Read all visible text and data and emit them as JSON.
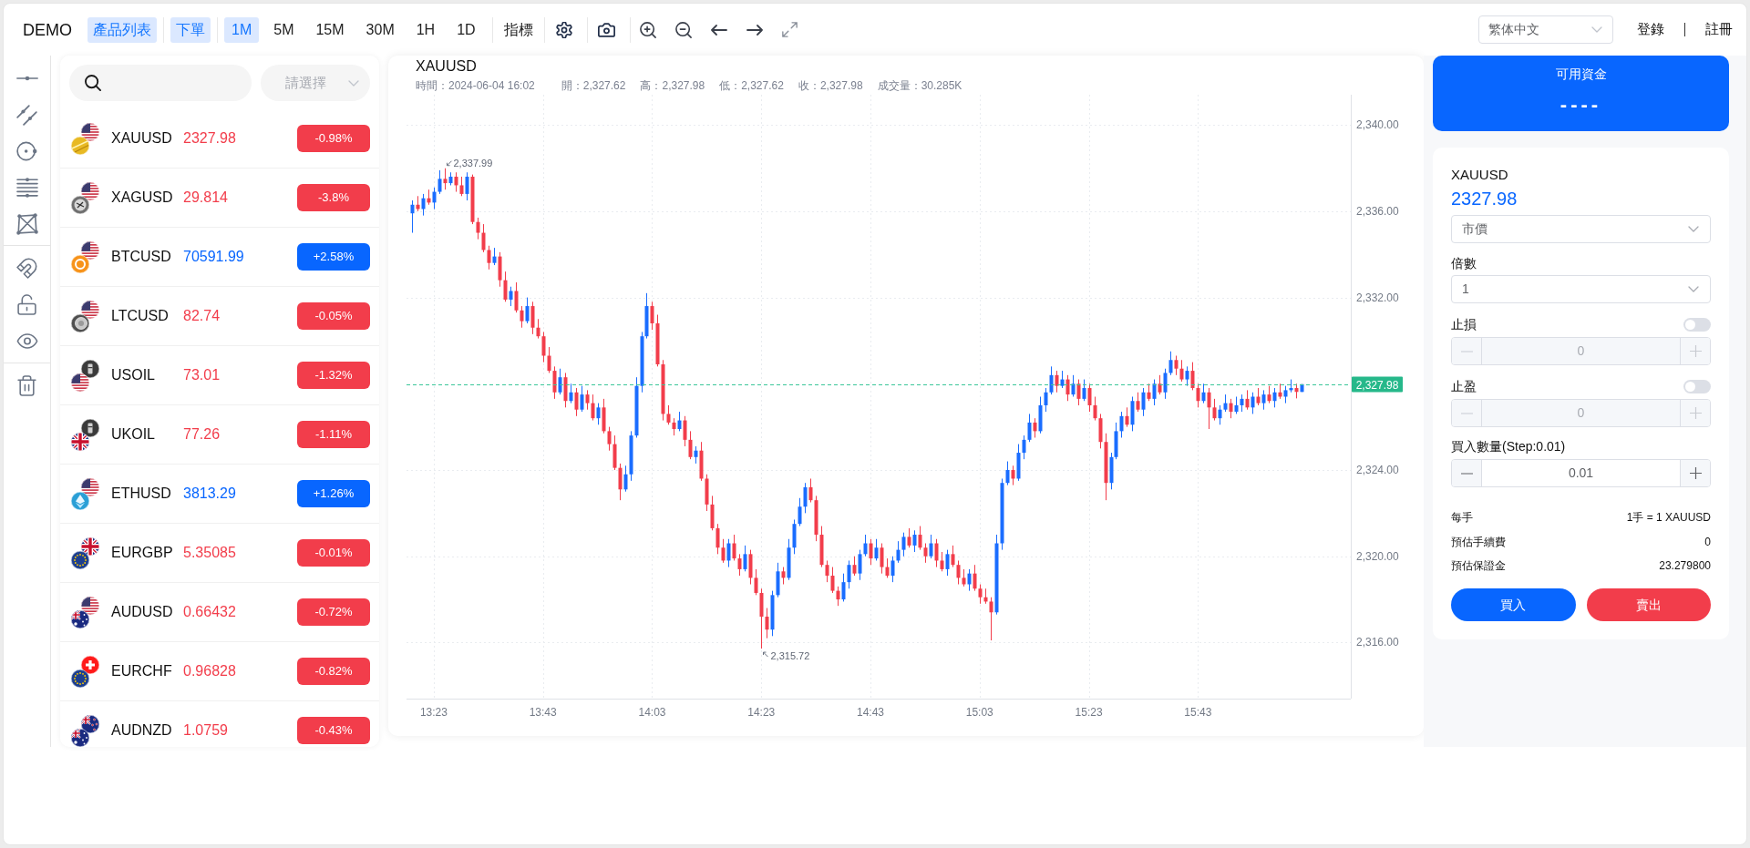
{
  "header": {
    "brand": "DEMO",
    "panels": [
      {
        "label": "產品列表",
        "on": true
      },
      {
        "label": "下單",
        "on": true
      }
    ],
    "timeframes": [
      {
        "label": "1M",
        "selected": true
      },
      {
        "label": "5M",
        "selected": false
      },
      {
        "label": "15M",
        "selected": false
      },
      {
        "label": "30M",
        "selected": false
      },
      {
        "label": "1H",
        "selected": false
      },
      {
        "label": "1D",
        "selected": false
      }
    ],
    "indicators": "指標",
    "language": "繁体中文",
    "login": "登錄",
    "register": "註冊"
  },
  "product_list": {
    "filter": {
      "placeholder": "請選擇"
    },
    "rows": [
      {
        "symbol": "XAUUSD",
        "price": "2327.98",
        "change": "-0.98%",
        "up": false
      },
      {
        "symbol": "XAGUSD",
        "price": "29.814",
        "change": "-3.8%",
        "up": false
      },
      {
        "symbol": "BTCUSD",
        "price": "70591.99",
        "change": "+2.58%",
        "up": true
      },
      {
        "symbol": "LTCUSD",
        "price": "82.74",
        "change": "-0.05%",
        "up": false
      },
      {
        "symbol": "USOIL",
        "price": "73.01",
        "change": "-1.32%",
        "up": false
      },
      {
        "symbol": "UKOIL",
        "price": "77.26",
        "change": "-1.11%",
        "up": false
      },
      {
        "symbol": "ETHUSD",
        "price": "3813.29",
        "change": "+1.26%",
        "up": true
      },
      {
        "symbol": "EURGBP",
        "price": "5.35085",
        "change": "-0.01%",
        "up": false
      },
      {
        "symbol": "AUDUSD",
        "price": "0.66432",
        "change": "-0.72%",
        "up": false
      },
      {
        "symbol": "EURCHF",
        "price": "0.96828",
        "change": "-0.82%",
        "up": false
      },
      {
        "symbol": "AUDNZD",
        "price": "1.0759",
        "change": "-0.43%",
        "up": false
      }
    ]
  },
  "chart": {
    "title": "XAUUSD",
    "legend": [
      "時間：2024-06-04 16:02",
      "開：2,327.62",
      "高：2,327.98",
      "低：2,327.62",
      "收：2,327.98",
      "成交量：30.285K"
    ],
    "chart_data": {
      "type": "candlestick",
      "x": [
        799,
        800,
        801,
        802,
        803,
        804,
        805,
        806,
        807,
        808,
        809,
        810,
        811,
        812,
        813,
        814,
        815,
        816,
        817,
        818,
        819,
        820,
        821,
        822,
        823,
        824,
        825,
        826,
        827,
        828,
        829,
        830,
        831,
        832,
        833,
        834,
        835,
        836,
        837,
        838,
        839,
        840,
        841,
        842,
        843,
        844,
        845,
        846,
        847,
        848,
        849,
        850,
        851,
        852,
        853,
        854,
        855,
        856,
        857,
        858,
        859,
        860,
        861,
        862,
        863,
        864,
        865,
        866,
        867,
        868,
        869,
        870,
        871,
        872,
        873,
        874,
        875,
        876,
        877,
        878,
        879,
        880,
        881,
        882,
        883,
        884,
        885,
        886,
        887,
        888,
        889,
        890,
        891,
        892,
        893,
        894,
        895,
        896,
        897,
        898,
        899,
        900,
        901,
        902,
        903,
        904,
        905,
        906,
        907,
        908,
        909,
        910,
        911,
        912,
        913,
        914,
        915,
        916,
        917,
        918,
        919,
        920,
        921,
        922,
        923,
        924,
        925,
        926,
        927,
        928,
        929,
        930,
        931,
        932,
        933,
        934,
        935,
        936,
        937,
        938,
        939,
        940,
        941,
        942,
        943,
        944,
        945,
        946,
        947,
        948,
        949,
        950,
        951,
        952,
        953,
        954,
        955,
        956,
        957,
        958,
        959,
        960,
        961,
        962
      ],
      "ohlc": [
        [
          2335.9,
          2336.5,
          2335.0,
          2336.3
        ],
        [
          2336.3,
          2336.7,
          2336.0,
          2336.1
        ],
        [
          2336.1,
          2336.8,
          2335.8,
          2336.6
        ],
        [
          2336.6,
          2337.0,
          2336.3,
          2336.4
        ],
        [
          2336.4,
          2337.1,
          2336.1,
          2336.9
        ],
        [
          2336.9,
          2337.9,
          2336.8,
          2337.5
        ],
        [
          2337.5,
          2337.99,
          2337.0,
          2337.3
        ],
        [
          2337.3,
          2337.8,
          2337.2,
          2337.6
        ],
        [
          2337.6,
          2337.8,
          2336.9,
          2337.2
        ],
        [
          2337.2,
          2337.6,
          2336.7,
          2336.8
        ],
        [
          2336.8,
          2337.8,
          2336.5,
          2337.6
        ],
        [
          2337.6,
          2337.7,
          2335.4,
          2335.5
        ],
        [
          2335.5,
          2335.7,
          2334.7,
          2335.0
        ],
        [
          2335.0,
          2335.4,
          2334.1,
          2334.2
        ],
        [
          2334.2,
          2334.4,
          2333.3,
          2333.6
        ],
        [
          2333.6,
          2334.3,
          2333.5,
          2333.9
        ],
        [
          2333.9,
          2334.1,
          2332.5,
          2332.8
        ],
        [
          2332.8,
          2333.2,
          2331.8,
          2331.9
        ],
        [
          2331.9,
          2332.5,
          2331.6,
          2332.3
        ],
        [
          2332.3,
          2332.7,
          2331.3,
          2331.4
        ],
        [
          2331.4,
          2331.6,
          2330.6,
          2330.9
        ],
        [
          2330.9,
          2332.0,
          2330.8,
          2331.6
        ],
        [
          2331.6,
          2331.8,
          2330.3,
          2330.6
        ],
        [
          2330.6,
          2331.0,
          2330.1,
          2330.2
        ],
        [
          2330.2,
          2330.4,
          2329.0,
          2329.3
        ],
        [
          2329.3,
          2329.7,
          2328.5,
          2328.6
        ],
        [
          2328.6,
          2328.8,
          2327.3,
          2327.6
        ],
        [
          2327.6,
          2328.7,
          2327.5,
          2328.3
        ],
        [
          2328.3,
          2328.5,
          2326.9,
          2327.2
        ],
        [
          2327.2,
          2328.0,
          2327.1,
          2327.6
        ],
        [
          2327.6,
          2327.8,
          2326.5,
          2326.8
        ],
        [
          2326.8,
          2327.9,
          2326.7,
          2327.5
        ],
        [
          2327.5,
          2327.7,
          2326.8,
          2327.1
        ],
        [
          2327.1,
          2327.5,
          2326.3,
          2326.4
        ],
        [
          2326.4,
          2327.1,
          2326.1,
          2326.9
        ],
        [
          2326.9,
          2327.3,
          2325.7,
          2325.8
        ],
        [
          2325.8,
          2326.0,
          2324.9,
          2325.2
        ],
        [
          2325.2,
          2325.6,
          2324.0,
          2324.1
        ],
        [
          2324.1,
          2324.3,
          2322.6,
          2323.1
        ],
        [
          2323.1,
          2324.2,
          2323.0,
          2323.8
        ],
        [
          2323.8,
          2325.8,
          2323.5,
          2325.6
        ],
        [
          2325.6,
          2328.3,
          2325.5,
          2327.9
        ],
        [
          2327.9,
          2330.4,
          2327.6,
          2330.2
        ],
        [
          2330.2,
          2332.2,
          2330.1,
          2331.6
        ],
        [
          2331.6,
          2331.8,
          2330.5,
          2330.8
        ],
        [
          2330.8,
          2331.2,
          2328.8,
          2328.9
        ],
        [
          2328.9,
          2329.1,
          2326.3,
          2326.6
        ],
        [
          2326.6,
          2327.0,
          2326.1,
          2326.2
        ],
        [
          2326.2,
          2326.4,
          2325.6,
          2325.9
        ],
        [
          2325.9,
          2326.7,
          2325.8,
          2326.3
        ],
        [
          2326.3,
          2326.5,
          2325.1,
          2325.4
        ],
        [
          2325.4,
          2325.8,
          2324.5,
          2324.6
        ],
        [
          2324.6,
          2325.1,
          2324.3,
          2324.9
        ],
        [
          2324.9,
          2325.3,
          2323.5,
          2323.6
        ],
        [
          2323.6,
          2323.8,
          2322.1,
          2322.4
        ],
        [
          2322.4,
          2322.8,
          2321.2,
          2321.3
        ],
        [
          2321.3,
          2321.5,
          2320.1,
          2320.4
        ],
        [
          2320.4,
          2320.8,
          2319.7,
          2319.8
        ],
        [
          2319.8,
          2320.8,
          2319.5,
          2320.6
        ],
        [
          2320.6,
          2321.0,
          2319.8,
          2319.9
        ],
        [
          2319.9,
          2320.1,
          2319.1,
          2319.4
        ],
        [
          2319.4,
          2320.5,
          2319.3,
          2320.1
        ],
        [
          2320.1,
          2320.3,
          2318.7,
          2319.0
        ],
        [
          2319.0,
          2319.4,
          2318.2,
          2318.3
        ],
        [
          2318.3,
          2318.5,
          2315.72,
          2317.2
        ],
        [
          2317.2,
          2317.6,
          2316.2,
          2316.6
        ],
        [
          2316.6,
          2318.4,
          2316.3,
          2318.2
        ],
        [
          2318.2,
          2319.7,
          2318.1,
          2319.3
        ],
        [
          2319.3,
          2319.5,
          2318.7,
          2319.0
        ],
        [
          2319.0,
          2320.8,
          2318.9,
          2320.4
        ],
        [
          2320.4,
          2321.7,
          2320.1,
          2321.5
        ],
        [
          2321.5,
          2322.7,
          2321.4,
          2322.3
        ],
        [
          2322.3,
          2323.4,
          2322.0,
          2323.2
        ],
        [
          2323.2,
          2323.6,
          2322.5,
          2322.6
        ],
        [
          2322.6,
          2322.8,
          2320.7,
          2321.0
        ],
        [
          2321.0,
          2321.4,
          2319.5,
          2319.6
        ],
        [
          2319.6,
          2319.8,
          2318.8,
          2319.1
        ],
        [
          2319.1,
          2319.5,
          2318.3,
          2318.4
        ],
        [
          2318.4,
          2318.6,
          2317.7,
          2318.0
        ],
        [
          2318.0,
          2319.2,
          2317.9,
          2318.8
        ],
        [
          2318.8,
          2319.8,
          2318.5,
          2319.6
        ],
        [
          2319.6,
          2320.0,
          2319.1,
          2319.2
        ],
        [
          2319.2,
          2320.3,
          2318.9,
          2320.1
        ],
        [
          2320.1,
          2321.0,
          2320.0,
          2320.6
        ],
        [
          2320.6,
          2320.8,
          2319.6,
          2319.9
        ],
        [
          2319.9,
          2320.8,
          2319.8,
          2320.4
        ],
        [
          2320.4,
          2320.6,
          2319.2,
          2319.5
        ],
        [
          2319.5,
          2319.9,
          2319.0,
          2319.1
        ],
        [
          2319.1,
          2320.0,
          2318.8,
          2319.8
        ],
        [
          2319.8,
          2320.7,
          2319.7,
          2320.3
        ],
        [
          2320.3,
          2321.1,
          2320.0,
          2320.9
        ],
        [
          2320.9,
          2321.3,
          2320.4,
          2320.5
        ],
        [
          2320.5,
          2321.2,
          2320.2,
          2321.0
        ],
        [
          2321.0,
          2321.4,
          2320.3,
          2320.4
        ],
        [
          2320.4,
          2320.6,
          2319.7,
          2320.0
        ],
        [
          2320.0,
          2321.0,
          2319.9,
          2320.6
        ],
        [
          2320.6,
          2320.8,
          2319.5,
          2319.8
        ],
        [
          2319.8,
          2320.2,
          2319.3,
          2319.4
        ],
        [
          2319.4,
          2320.3,
          2319.1,
          2320.1
        ],
        [
          2320.1,
          2320.5,
          2319.5,
          2319.6
        ],
        [
          2319.6,
          2319.8,
          2318.7,
          2319.0
        ],
        [
          2319.0,
          2319.4,
          2318.6,
          2318.7
        ],
        [
          2318.7,
          2319.4,
          2318.4,
          2319.2
        ],
        [
          2319.2,
          2319.6,
          2318.4,
          2318.5
        ],
        [
          2318.5,
          2318.7,
          2317.8,
          2318.1
        ],
        [
          2318.1,
          2318.5,
          2317.8,
          2317.9
        ],
        [
          2317.9,
          2318.1,
          2316.1,
          2317.4
        ],
        [
          2317.4,
          2321.0,
          2317.3,
          2320.6
        ],
        [
          2320.6,
          2323.6,
          2320.3,
          2323.4
        ],
        [
          2323.4,
          2324.4,
          2323.3,
          2324.0
        ],
        [
          2324.0,
          2324.2,
          2323.3,
          2323.6
        ],
        [
          2323.6,
          2325.2,
          2323.5,
          2324.8
        ],
        [
          2324.8,
          2325.6,
          2324.5,
          2325.4
        ],
        [
          2325.4,
          2326.6,
          2325.3,
          2326.2
        ],
        [
          2326.2,
          2326.4,
          2325.5,
          2325.8
        ],
        [
          2325.8,
          2327.4,
          2325.7,
          2327.0
        ],
        [
          2327.0,
          2327.8,
          2326.7,
          2327.6
        ],
        [
          2327.6,
          2328.8,
          2327.5,
          2328.4
        ],
        [
          2328.4,
          2328.6,
          2327.6,
          2327.9
        ],
        [
          2327.9,
          2328.6,
          2327.8,
          2328.2
        ],
        [
          2328.2,
          2328.4,
          2327.2,
          2327.5
        ],
        [
          2327.5,
          2328.4,
          2327.4,
          2328.0
        ],
        [
          2328.0,
          2328.2,
          2327.0,
          2327.3
        ],
        [
          2327.3,
          2328.2,
          2327.2,
          2327.8
        ],
        [
          2327.8,
          2328.0,
          2326.7,
          2327.0
        ],
        [
          2327.0,
          2327.4,
          2326.3,
          2326.4
        ],
        [
          2326.4,
          2326.6,
          2325.0,
          2325.3
        ],
        [
          2325.3,
          2325.7,
          2322.6,
          2323.4
        ],
        [
          2323.4,
          2324.8,
          2323.1,
          2324.6
        ],
        [
          2324.6,
          2326.2,
          2324.5,
          2325.8
        ],
        [
          2325.8,
          2326.7,
          2325.5,
          2326.5
        ],
        [
          2326.5,
          2326.9,
          2326.0,
          2326.1
        ],
        [
          2326.1,
          2327.4,
          2325.8,
          2327.2
        ],
        [
          2327.2,
          2327.6,
          2326.7,
          2326.8
        ],
        [
          2326.8,
          2327.8,
          2326.5,
          2327.6
        ],
        [
          2327.6,
          2328.0,
          2327.2,
          2327.3
        ],
        [
          2327.3,
          2328.2,
          2327.0,
          2328.0
        ],
        [
          2328.0,
          2328.4,
          2327.5,
          2327.6
        ],
        [
          2327.6,
          2328.7,
          2327.3,
          2328.5
        ],
        [
          2328.5,
          2329.5,
          2328.4,
          2329.1
        ],
        [
          2329.1,
          2329.3,
          2328.4,
          2328.7
        ],
        [
          2328.7,
          2329.1,
          2328.1,
          2328.2
        ],
        [
          2328.2,
          2328.8,
          2327.9,
          2328.6
        ],
        [
          2328.6,
          2329.0,
          2327.7,
          2327.8
        ],
        [
          2327.8,
          2328.0,
          2326.9,
          2327.2
        ],
        [
          2327.2,
          2328.0,
          2327.1,
          2327.6
        ],
        [
          2327.6,
          2327.8,
          2325.9,
          2326.9
        ],
        [
          2326.9,
          2327.3,
          2326.3,
          2326.4
        ],
        [
          2326.4,
          2327.0,
          2326.1,
          2326.8
        ],
        [
          2326.8,
          2327.5,
          2326.7,
          2327.1
        ],
        [
          2327.1,
          2327.3,
          2326.4,
          2326.7
        ],
        [
          2326.7,
          2327.4,
          2326.6,
          2327.0
        ],
        [
          2327.0,
          2327.5,
          2326.7,
          2327.3
        ],
        [
          2327.3,
          2327.7,
          2326.8,
          2326.9
        ],
        [
          2326.9,
          2327.6,
          2326.6,
          2327.4
        ],
        [
          2327.4,
          2327.8,
          2327.0,
          2327.1
        ],
        [
          2327.1,
          2327.7,
          2326.8,
          2327.5
        ],
        [
          2327.5,
          2327.9,
          2327.1,
          2327.2
        ],
        [
          2327.2,
          2327.8,
          2326.9,
          2327.6
        ],
        [
          2327.6,
          2328.0,
          2327.3,
          2327.4
        ],
        [
          2327.4,
          2327.9,
          2327.1,
          2327.7
        ],
        [
          2327.7,
          2328.2,
          2327.6,
          2327.8
        ],
        [
          2327.8,
          2328.0,
          2327.32,
          2327.62
        ],
        [
          2327.62,
          2327.98,
          2327.62,
          2327.98
        ]
      ],
      "xlim": [
        798,
        971
      ],
      "ylim": [
        2313.4,
        2341.4
      ],
      "xticks": [
        {
          "value": 803,
          "label": "13:23"
        },
        {
          "value": 823,
          "label": "13:43"
        },
        {
          "value": 843,
          "label": "14:03"
        },
        {
          "value": 863,
          "label": "14:23"
        },
        {
          "value": 883,
          "label": "14:43"
        },
        {
          "value": 903,
          "label": "15:03"
        },
        {
          "value": 923,
          "label": "15:23"
        },
        {
          "value": 943,
          "label": "15:43"
        }
      ],
      "yticks": [
        {
          "value": 2340,
          "label": "2,340.00"
        },
        {
          "value": 2336,
          "label": "2,336.00"
        },
        {
          "value": 2332,
          "label": "2,332.00"
        },
        {
          "value": 2324,
          "label": "2,324.00"
        },
        {
          "value": 2320,
          "label": "2,320.00"
        },
        {
          "value": 2316,
          "label": "2,316.00"
        }
      ],
      "grid": true,
      "ref_lines": [
        {
          "axis": "y",
          "value": 2327.98,
          "label": "2,327.98"
        }
      ],
      "annotations": [
        {
          "text": "2,337.99",
          "x": 805,
          "y": 2337.99
        },
        {
          "text": "2,315.72",
          "x": 863,
          "y": 2315.72
        }
      ]
    }
  },
  "funds": {
    "label": "可用資金",
    "value": "----"
  },
  "order_form": {
    "symbol": "XAUUSD",
    "price": "2327.98",
    "order_type": "市價",
    "leverage": {
      "label": "倍數",
      "value": "1"
    },
    "stop_loss": {
      "label": "止損",
      "on": false,
      "value": "0"
    },
    "take_profit": {
      "label": "止盈",
      "on": false,
      "value": "0"
    },
    "quantity": {
      "label": "買入數量(Step:0.01)",
      "value": "0.01"
    },
    "details": [
      {
        "label": "每手",
        "value": "1手 = 1 XAUUSD"
      },
      {
        "label": "預估手續費",
        "value": "0"
      },
      {
        "label": "預估保證金",
        "value": "23.279800"
      }
    ],
    "buttons": [
      {
        "label": "買入",
        "kind": "buy"
      },
      {
        "label": "賣出",
        "kind": "sell"
      }
    ]
  }
}
